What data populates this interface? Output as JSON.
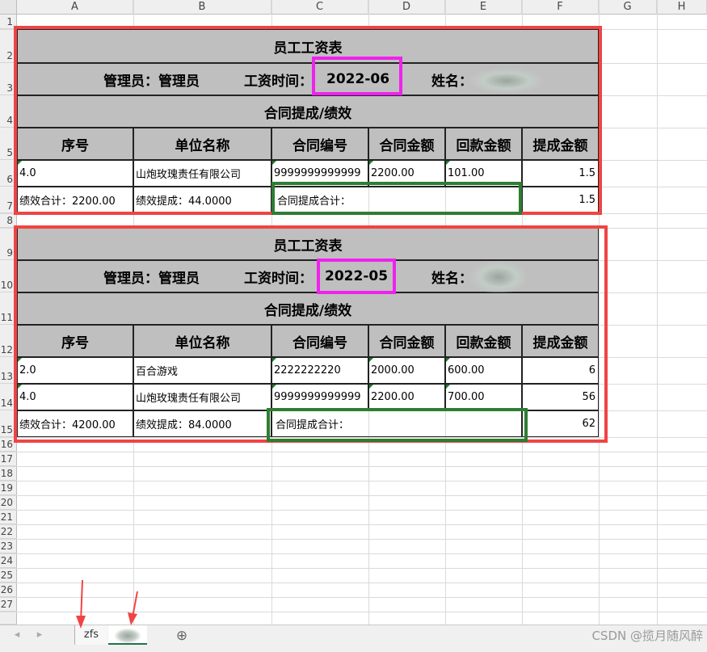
{
  "columns": [
    "A",
    "B",
    "C",
    "D",
    "E",
    "F",
    "G",
    "H"
  ],
  "rows": [
    "1",
    "2",
    "3",
    "4",
    "5",
    "6",
    "7",
    "8",
    "9",
    "10",
    "11",
    "12",
    "13",
    "14",
    "15",
    "16",
    "17",
    "18",
    "19",
    "20",
    "21",
    "22",
    "23",
    "24",
    "25",
    "26",
    "27"
  ],
  "table1": {
    "title": "员工工资表",
    "manager_label": "管理员：管理员",
    "time_label": "工资时间：",
    "time_value": "2022-06",
    "name_label": "姓名：",
    "section_title": "合同提成/绩效",
    "headers": [
      "序号",
      "单位名称",
      "合同编号",
      "合同金额",
      "回款金额",
      "提成金额"
    ],
    "data_rows": [
      [
        "4.0",
        "山炮玫瑰责任有限公司",
        "9999999999999",
        "2200.00",
        "101.00",
        "1.5"
      ]
    ],
    "summary": {
      "perf_total": "绩效合计：2200.00",
      "perf_comm": "绩效提成：44.0000",
      "contract_comm_label": "合同提成合计：",
      "contract_comm_value": "1.5"
    }
  },
  "table2": {
    "title": "员工工资表",
    "manager_label": "管理员：管理员",
    "time_label": "工资时间：",
    "time_value": "2022-05",
    "name_label": "姓名：",
    "section_title": "合同提成/绩效",
    "headers": [
      "序号",
      "单位名称",
      "合同编号",
      "合同金额",
      "回款金额",
      "提成金额"
    ],
    "data_rows": [
      [
        "2.0",
        "百合游戏",
        "2222222220",
        "2000.00",
        "600.00",
        "6"
      ],
      [
        "4.0",
        "山炮玫瑰责任有限公司",
        "9999999999999",
        "2200.00",
        "700.00",
        "56"
      ]
    ],
    "summary": {
      "perf_total": "绩效合计：4200.00",
      "perf_comm": "绩效提成：84.0000",
      "contract_comm_label": "合同提成合计：",
      "contract_comm_value": "62"
    }
  },
  "sheet_tabs": {
    "nav_prev": "◂",
    "nav_next": "▸",
    "tab1": "zfs",
    "add": "⊕"
  },
  "watermark": "CSDN @揽月随风醉",
  "colors": {
    "annotation_red": "#f04444",
    "annotation_pink": "#ee22ee",
    "annotation_green": "#2e7d32",
    "header_gray": "#bfbfbf"
  }
}
